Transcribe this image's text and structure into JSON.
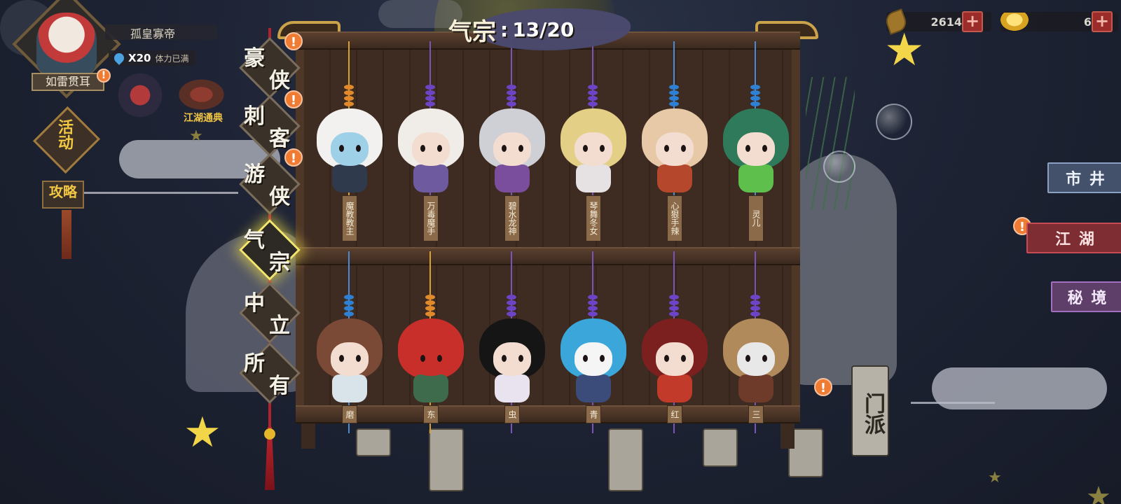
{
  "player": {
    "name": "孤皇寡帝",
    "stamina_value": "X20",
    "stamina_status": "体力已满",
    "title": "如雷贯耳"
  },
  "left_menu": {
    "codex_label": "江湖通典",
    "activity_label": "活动",
    "strategy_label": "攻略"
  },
  "currency": {
    "copper": "2614",
    "gold": "6"
  },
  "collection": {
    "current_category": "气宗",
    "progress": "13/20"
  },
  "categories": [
    {
      "label": "豪侠",
      "alert": true,
      "active": false
    },
    {
      "label": "刺客",
      "alert": true,
      "active": false
    },
    {
      "label": "游侠",
      "alert": true,
      "active": false
    },
    {
      "label": "气宗",
      "alert": false,
      "active": true
    },
    {
      "label": "中立",
      "alert": false,
      "active": false
    },
    {
      "label": "所有",
      "alert": false,
      "active": false
    }
  ],
  "shelf_top": [
    {
      "name": "魔教教主",
      "string_color": "#d8a032",
      "bead_color": "#e08a2b",
      "hair": "#f3f1ef",
      "outfit": "#2f3b4d",
      "face": "#9ed1e8"
    },
    {
      "name": "万毒魔手",
      "string_color": "#7a54b8",
      "bead_color": "#6d44c6",
      "hair": "#f0ece8",
      "outfit": "#6e5a9e",
      "face": "#f3dcd0"
    },
    {
      "name": "碧水龙神",
      "string_color": "#7a54b8",
      "bead_color": "#6d44c6",
      "hair": "#cfcfd6",
      "outfit": "#7a4e9c",
      "face": "#f3dcd0"
    },
    {
      "name": "琴舞冬女",
      "string_color": "#7a54b8",
      "bead_color": "#6d44c6",
      "hair": "#e4cf86",
      "outfit": "#e6e1e3",
      "face": "#f3dcd0"
    },
    {
      "name": "心狠手辣",
      "string_color": "#4c8bd1",
      "bead_color": "#2f7fd3",
      "hair": "#e8c9a7",
      "outfit": "#b5482c",
      "face": "#f3dcd0"
    },
    {
      "name": "灵儿",
      "string_color": "#4c8bd1",
      "bead_color": "#2f7fd3",
      "hair": "#2f7a5a",
      "outfit": "#5fbf4d",
      "face": "#f3dcd0"
    }
  ],
  "shelf_bottom": [
    {
      "name": "磨",
      "string_color": "#4c8bd1",
      "bead_color": "#2f7fd3",
      "hair": "#7a4a36",
      "outfit": "#d9e3ea",
      "face": "#f3dcd0"
    },
    {
      "name": "东",
      "string_color": "#d8a032",
      "bead_color": "#e08a2b",
      "hair": "#c92f2a",
      "outfit": "#3d6b4b",
      "face": "#c92f2a"
    },
    {
      "name": "虫",
      "string_color": "#7a54b8",
      "bead_color": "#6d44c6",
      "hair": "#151515",
      "outfit": "#e9e3f0",
      "face": "#f3dcd0"
    },
    {
      "name": "青",
      "string_color": "#7a54b8",
      "bead_color": "#6d44c6",
      "hair": "#3aa6d9",
      "outfit": "#3b4c7a",
      "face": "#f5f5f5"
    },
    {
      "name": "红",
      "string_color": "#7a54b8",
      "bead_color": "#6d44c6",
      "hair": "#7c1f1f",
      "outfit": "#c23a2a",
      "face": "#f3dcd0"
    },
    {
      "name": "三",
      "string_color": "#7a54b8",
      "bead_color": "#6d44c6",
      "hair": "#b08a5a",
      "outfit": "#6e3a2a",
      "face": "#e8e8e8"
    }
  ],
  "right_nav": {
    "market": "市 井",
    "jianghu": "江 湖",
    "secret_realm": "秘 境",
    "sect": "门派"
  }
}
